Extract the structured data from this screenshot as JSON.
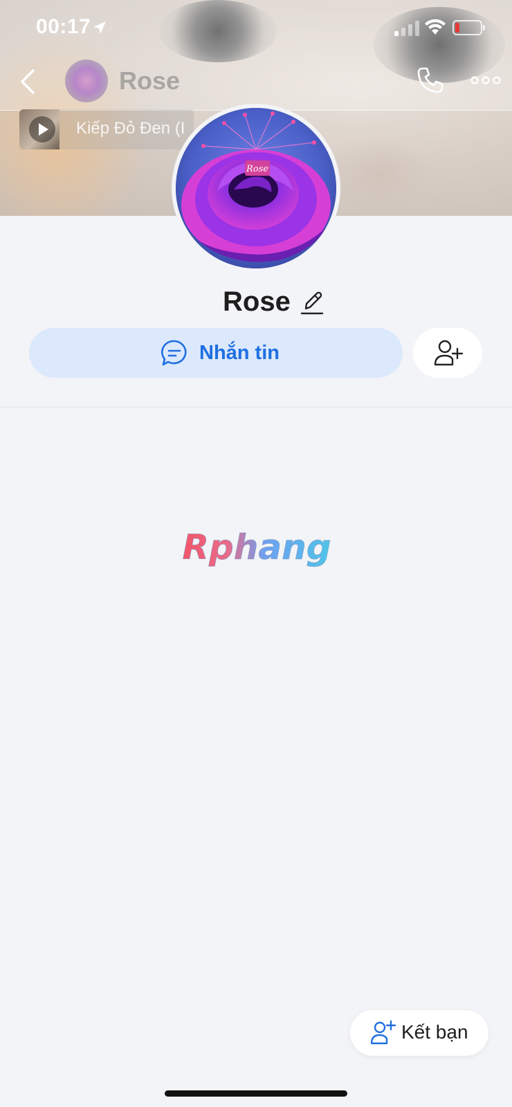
{
  "status_bar": {
    "time": "00:17",
    "battery_color": "#e53935"
  },
  "header": {
    "title": "Rose"
  },
  "music": {
    "title": "Kiếp Đỏ Đen (I"
  },
  "profile": {
    "name": "Rose",
    "avatar_caption": "Rose"
  },
  "actions": {
    "message_label": "Nhắn tin",
    "accent_color": "#1f6fe0"
  },
  "watermark": {
    "text": "Rphang"
  },
  "fab": {
    "add_friend_label": "Kết bạn"
  }
}
